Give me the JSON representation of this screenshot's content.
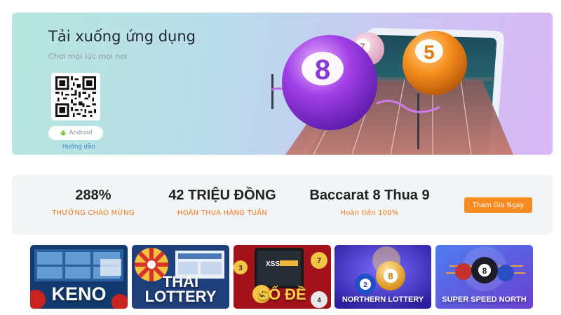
{
  "banner": {
    "title": "Tải xuống ứng dụng",
    "subtitle": "Chơi mọi lúc mọi nơi",
    "android_label": "Android",
    "guide_label": "Hướng dẫn",
    "balls": [
      "8",
      "5",
      "7"
    ]
  },
  "promo": {
    "items": [
      {
        "value": "288%",
        "label": "THƯỞNG CHÀO MỪNG"
      },
      {
        "value": "42 TRIỆU ĐỒNG",
        "label": "HOÀN THUA HÀNG TUẦN"
      },
      {
        "value": "Baccarat 8 Thua 9",
        "label": "Hoàn tiền 100%"
      }
    ],
    "join_label": "Tham Gia Ngay"
  },
  "games": [
    {
      "label": "KENO"
    },
    {
      "label_line1": "THAI",
      "label_line2": "LOTTERY"
    },
    {
      "label": "SỐ ĐỀ",
      "screen_text": "XSST",
      "balls": [
        "3",
        "7",
        "5",
        "4"
      ]
    },
    {
      "label": "NORTHERN LOTTERY",
      "balls": [
        "2",
        "8"
      ]
    },
    {
      "label": "SUPER SPEED NORTH",
      "balls": [
        "8"
      ]
    }
  ],
  "colors": {
    "accent": "#f78a20",
    "label_orange": "#f07a22",
    "link_blue": "#3b82c9"
  }
}
